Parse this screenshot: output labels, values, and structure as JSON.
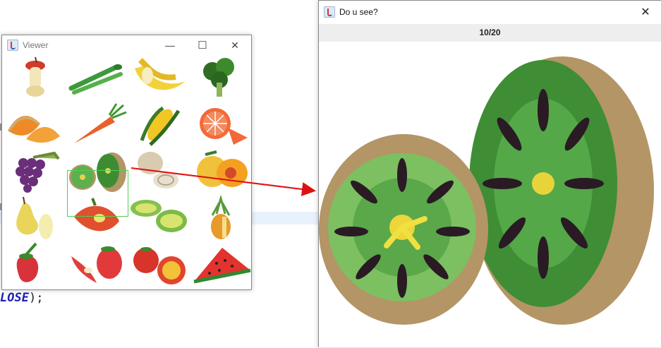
{
  "background": {
    "code_keyword": "LOSE",
    "code_suffix": ");"
  },
  "viewer": {
    "title": "Viewer",
    "controls": {
      "minimize": "—",
      "maximize": "☐",
      "close": "✕"
    },
    "items": [
      {
        "name": "apple-core"
      },
      {
        "name": "asparagus"
      },
      {
        "name": "banana"
      },
      {
        "name": "broccoli"
      },
      {
        "name": "cantaloupe"
      },
      {
        "name": "carrot"
      },
      {
        "name": "corn"
      },
      {
        "name": "grapefruit"
      },
      {
        "name": "grapes"
      },
      {
        "name": "kiwi"
      },
      {
        "name": "onion"
      },
      {
        "name": "peach"
      },
      {
        "name": "pear"
      },
      {
        "name": "pepper"
      },
      {
        "name": "cucumber"
      },
      {
        "name": "pineapple"
      },
      {
        "name": "strawberry"
      },
      {
        "name": "chili-strawberry"
      },
      {
        "name": "tomato"
      },
      {
        "name": "watermelon"
      }
    ],
    "selected_index": 9
  },
  "detail": {
    "title": "Do u see?",
    "close": "✕",
    "counter": "10/20"
  },
  "colors": {
    "selection": "#4fd04f",
    "arrow": "#e01010"
  }
}
